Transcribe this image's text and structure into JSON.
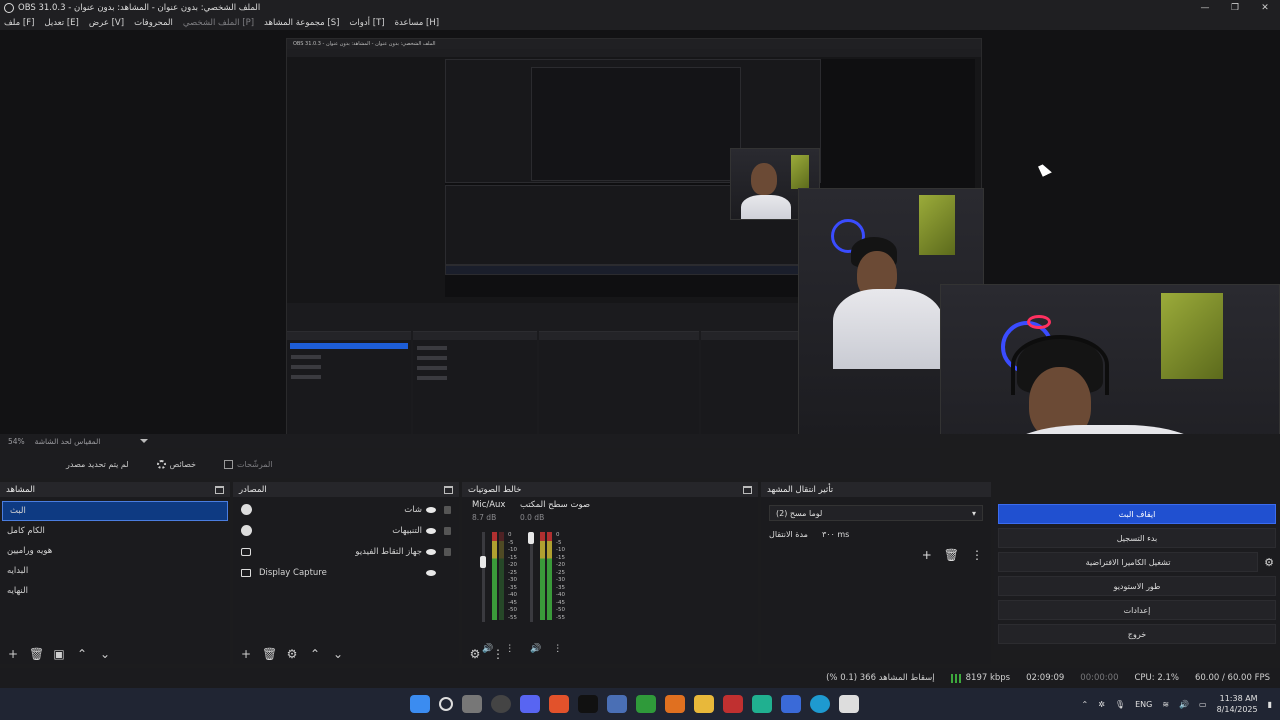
{
  "window": {
    "title": "OBS 31.0.3 - الملف الشخصي: بدون عنوان - المشاهد: بدون عنوان",
    "minimize": "—",
    "maximize": "❐",
    "close": "✕"
  },
  "menu": {
    "items": [
      "ملف [F]",
      "تعديل [E]",
      "عرض [V]",
      "المحروفات",
      "الملف الشخصي [P]",
      "مجموعة المشاهد [S]",
      "أدوات [T]",
      "مساعدة [H]"
    ]
  },
  "preview_bar": {
    "zoom": "54%",
    "scale_label": "المقياس لحد الشاشة"
  },
  "controls_row": {
    "no_selection": "لم يتم تحديد مصدر",
    "properties": "خصائص",
    "filters": "المرشّحات"
  },
  "scenes": {
    "title": "المشاهد",
    "items": [
      "البث",
      "الكام كامل",
      "هويه وراميين",
      "البدايه",
      "النهايه"
    ],
    "selected_index": 0,
    "footer": [
      "+",
      "🗑",
      "▣",
      "⌃",
      "⌄"
    ]
  },
  "sources": {
    "title": "المصادر",
    "items": [
      {
        "label": "شات",
        "icon": "globe-icon"
      },
      {
        "label": "التنبيهات",
        "icon": "globe-icon"
      },
      {
        "label": "جهاز التقاط الفيديو",
        "icon": "camera-icon"
      },
      {
        "label": "Display Capture",
        "icon": "monitor-icon"
      }
    ],
    "footer": [
      "+",
      "🗑",
      "⚙",
      "⌃",
      "⌄"
    ]
  },
  "mixer": {
    "title": "خالط الصوتيات",
    "channels": [
      {
        "name": "Mic/Aux",
        "db": "8.7 dB",
        "level": 0.55
      },
      {
        "name": "صوت سطح المكتب",
        "db": "0.0 dB",
        "level": 0.85
      }
    ],
    "scale": [
      "0",
      "-5",
      "-10",
      "-15",
      "-20",
      "-25",
      "-30",
      "-35",
      "-40",
      "-45",
      "-50",
      "-55",
      "-60"
    ]
  },
  "transitions": {
    "title": "تأثير انتقال المشهد",
    "selected": "لوما مسح (2)",
    "duration_label": "مدة الانتقال",
    "duration_value": "٣٠٠ ms"
  },
  "controls": {
    "buttons": [
      "ايقاف البث",
      "بدء التسجيل",
      "تشغيل الكاميرا الافتراضية",
      "طور الاستوديو",
      "إعدادات",
      "خروج"
    ],
    "active_index": 0
  },
  "status": {
    "dropped": "إسقاط المشاهد 366 (0.1 %)",
    "bitrate": "8197 kbps",
    "stream_time": "02:09:09",
    "rec_time": "00:00:00",
    "cpu": "CPU: 2.1%",
    "fps": "60.00 / 60.00 FPS"
  },
  "taskbar": {
    "lang": "ENG",
    "time": "11:38 AM",
    "date": "8/14/2025"
  },
  "nested_title": "OBS 31.0.3 - الملف الشخصي: بدون عنوان - المشاهد: بدون عنوان"
}
